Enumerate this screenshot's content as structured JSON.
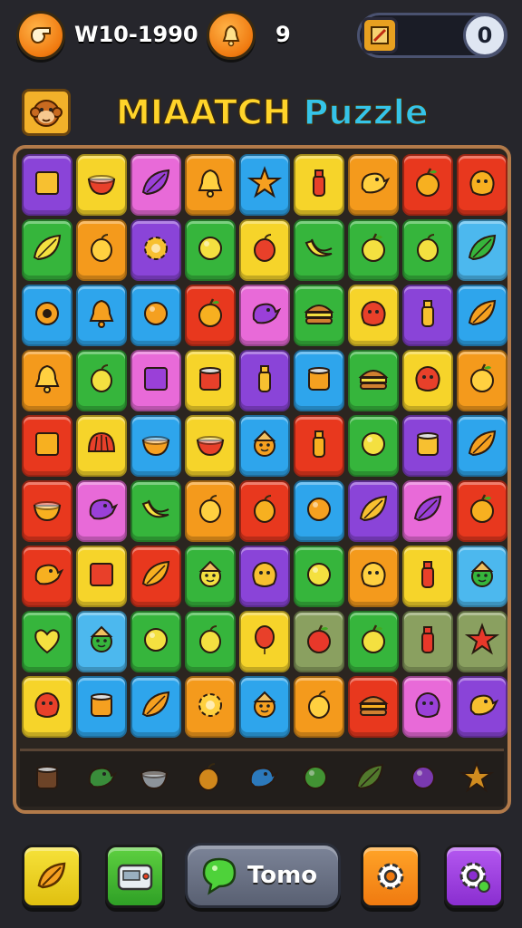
{
  "hud": {
    "score_text": "W10-1990",
    "moves_text": "9",
    "meter_count": "0",
    "left_icon": "whistle-icon",
    "mid_icon": "bell-icon",
    "meter_icon": "note-icon"
  },
  "title": {
    "word1": "MIAATCH",
    "word2": "Puzzle",
    "icon": "monkey-face-icon"
  },
  "colors": {
    "yellow": "#f6d42a",
    "orange": "#f49a1c",
    "green": "#36b53c",
    "blue": "#2ea5ec",
    "purple": "#8a44d8",
    "pink": "#e86ad8",
    "red": "#e8381e",
    "lightblue": "#4cb8ee",
    "lime": "#7cc43a",
    "olive": "#8aa060"
  },
  "board": {
    "rows": [
      [
        {
          "c": "purple",
          "i": "square"
        },
        {
          "c": "yellow",
          "i": "bowl"
        },
        {
          "c": "pink",
          "i": "leaf"
        },
        {
          "c": "orange",
          "i": "bell"
        },
        {
          "c": "blue",
          "i": "star"
        },
        {
          "c": "yellow",
          "i": "bottle"
        },
        {
          "c": "orange",
          "i": "bird"
        },
        {
          "c": "red",
          "i": "apple"
        },
        {
          "c": "red",
          "i": "blob"
        }
      ],
      [
        {
          "c": "green",
          "i": "leaf"
        },
        {
          "c": "orange",
          "i": "fruit"
        },
        {
          "c": "purple",
          "i": "flower"
        },
        {
          "c": "green",
          "i": "circle"
        },
        {
          "c": "yellow",
          "i": "fruit"
        },
        {
          "c": "green",
          "i": "banana"
        },
        {
          "c": "green",
          "i": "apple"
        },
        {
          "c": "green",
          "i": "fruit"
        },
        {
          "c": "lightblue",
          "i": "leaf"
        }
      ],
      [
        {
          "c": "blue",
          "i": "ring"
        },
        {
          "c": "blue",
          "i": "bell"
        },
        {
          "c": "blue",
          "i": "circle"
        },
        {
          "c": "red",
          "i": "apple"
        },
        {
          "c": "pink",
          "i": "bird"
        },
        {
          "c": "green",
          "i": "burger"
        },
        {
          "c": "yellow",
          "i": "blob"
        },
        {
          "c": "purple",
          "i": "bottle"
        },
        {
          "c": "blue",
          "i": "leaf"
        }
      ],
      [
        {
          "c": "orange",
          "i": "bell"
        },
        {
          "c": "green",
          "i": "fruit"
        },
        {
          "c": "pink",
          "i": "square"
        },
        {
          "c": "yellow",
          "i": "can"
        },
        {
          "c": "purple",
          "i": "bottle"
        },
        {
          "c": "blue",
          "i": "can"
        },
        {
          "c": "green",
          "i": "burger"
        },
        {
          "c": "yellow",
          "i": "blob"
        },
        {
          "c": "orange",
          "i": "apple"
        }
      ],
      [
        {
          "c": "red",
          "i": "square"
        },
        {
          "c": "yellow",
          "i": "shell"
        },
        {
          "c": "blue",
          "i": "bowl"
        },
        {
          "c": "yellow",
          "i": "bowl"
        },
        {
          "c": "blue",
          "i": "face"
        },
        {
          "c": "red",
          "i": "bottle"
        },
        {
          "c": "green",
          "i": "circle"
        },
        {
          "c": "purple",
          "i": "can"
        },
        {
          "c": "blue",
          "i": "leaf"
        }
      ],
      [
        {
          "c": "red",
          "i": "bowl"
        },
        {
          "c": "pink",
          "i": "bird"
        },
        {
          "c": "green",
          "i": "banana"
        },
        {
          "c": "orange",
          "i": "fruit"
        },
        {
          "c": "red",
          "i": "fruit"
        },
        {
          "c": "blue",
          "i": "circle"
        },
        {
          "c": "purple",
          "i": "leaf"
        },
        {
          "c": "pink",
          "i": "leaf"
        },
        {
          "c": "red",
          "i": "apple"
        }
      ],
      [
        {
          "c": "red",
          "i": "bird"
        },
        {
          "c": "yellow",
          "i": "square"
        },
        {
          "c": "red",
          "i": "leaf"
        },
        {
          "c": "green",
          "i": "face"
        },
        {
          "c": "purple",
          "i": "blob"
        },
        {
          "c": "green",
          "i": "circle"
        },
        {
          "c": "orange",
          "i": "blob"
        },
        {
          "c": "yellow",
          "i": "bottle"
        },
        {
          "c": "lightblue",
          "i": "face"
        }
      ],
      [
        {
          "c": "green",
          "i": "heart"
        },
        {
          "c": "lightblue",
          "i": "face"
        },
        {
          "c": "green",
          "i": "circle"
        },
        {
          "c": "green",
          "i": "fruit"
        },
        {
          "c": "yellow",
          "i": "balloon"
        },
        {
          "c": "olive",
          "i": "apple"
        },
        {
          "c": "green",
          "i": "apple"
        },
        {
          "c": "olive",
          "i": "bottle"
        },
        {
          "c": "olive",
          "i": "star"
        }
      ],
      [
        {
          "c": "yellow",
          "i": "blob"
        },
        {
          "c": "blue",
          "i": "can"
        },
        {
          "c": "blue",
          "i": "leaf"
        },
        {
          "c": "orange",
          "i": "flower"
        },
        {
          "c": "blue",
          "i": "face"
        },
        {
          "c": "orange",
          "i": "fruit"
        },
        {
          "c": "red",
          "i": "burger"
        },
        {
          "c": "pink",
          "i": "blob"
        },
        {
          "c": "purple",
          "i": "bird"
        }
      ]
    ],
    "tray": [
      {
        "c": "#7a4a2a",
        "i": "can"
      },
      {
        "c": "#3ea040",
        "i": "bird"
      },
      {
        "c": "#a0a8b0",
        "i": "bowl"
      },
      {
        "c": "#f09a1c",
        "i": "fruit"
      },
      {
        "c": "#2e8ad8",
        "i": "bird"
      },
      {
        "c": "#48a838",
        "i": "circle"
      },
      {
        "c": "#5a8a30",
        "i": "leaf"
      },
      {
        "c": "#8a3ec8",
        "i": "circle"
      },
      {
        "c": "#f0a020",
        "i": "star"
      }
    ]
  },
  "bottom": {
    "btn1_icon": "leaf-icon",
    "btn2_icon": "toaster-icon",
    "center_label": "Tomo",
    "center_icon": "chat-bubble-icon",
    "btn4_icon": "settings-icon",
    "btn5_icon": "gear-icon"
  }
}
